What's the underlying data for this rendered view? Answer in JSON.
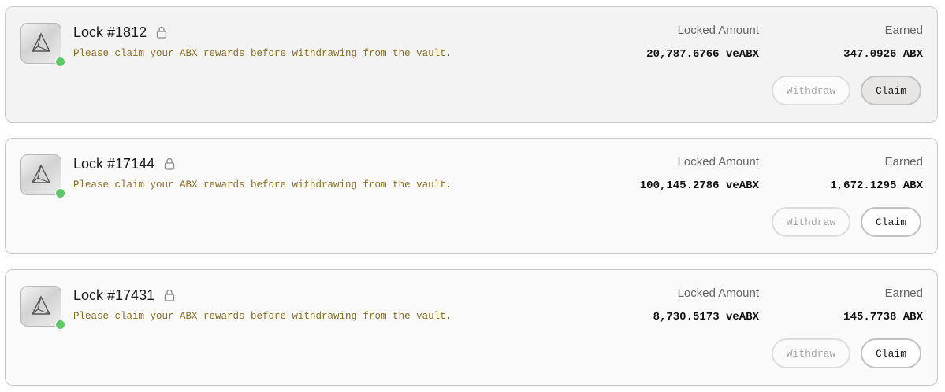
{
  "locks": [
    {
      "title": "Lock #1812",
      "notice": "Please claim your ABX rewards before withdrawing from the vault.",
      "locked_label": "Locked Amount",
      "locked_value": "20,787.6766 veABX",
      "earned_label": "Earned",
      "earned_value": "347.0926 ABX",
      "withdraw_label": "Withdraw",
      "claim_label": "Claim"
    },
    {
      "title": "Lock #17144",
      "notice": "Please claim your ABX rewards before withdrawing from the vault.",
      "locked_label": "Locked Amount",
      "locked_value": "100,145.2786 veABX",
      "earned_label": "Earned",
      "earned_value": "1,672.1295 ABX",
      "withdraw_label": "Withdraw",
      "claim_label": "Claim"
    },
    {
      "title": "Lock #17431",
      "notice": "Please claim your ABX rewards before withdrawing from the vault.",
      "locked_label": "Locked Amount",
      "locked_value": "8,730.5173 veABX",
      "earned_label": "Earned",
      "earned_value": "145.7738 ABX",
      "withdraw_label": "Withdraw",
      "claim_label": "Claim"
    }
  ],
  "icons": {
    "token_logo": "abx-token-icon",
    "lock": "lock-icon",
    "status": "status-dot"
  },
  "colors": {
    "notice": "#8a6f1d",
    "status_active": "#5dc966",
    "border": "#c9c9c9"
  }
}
